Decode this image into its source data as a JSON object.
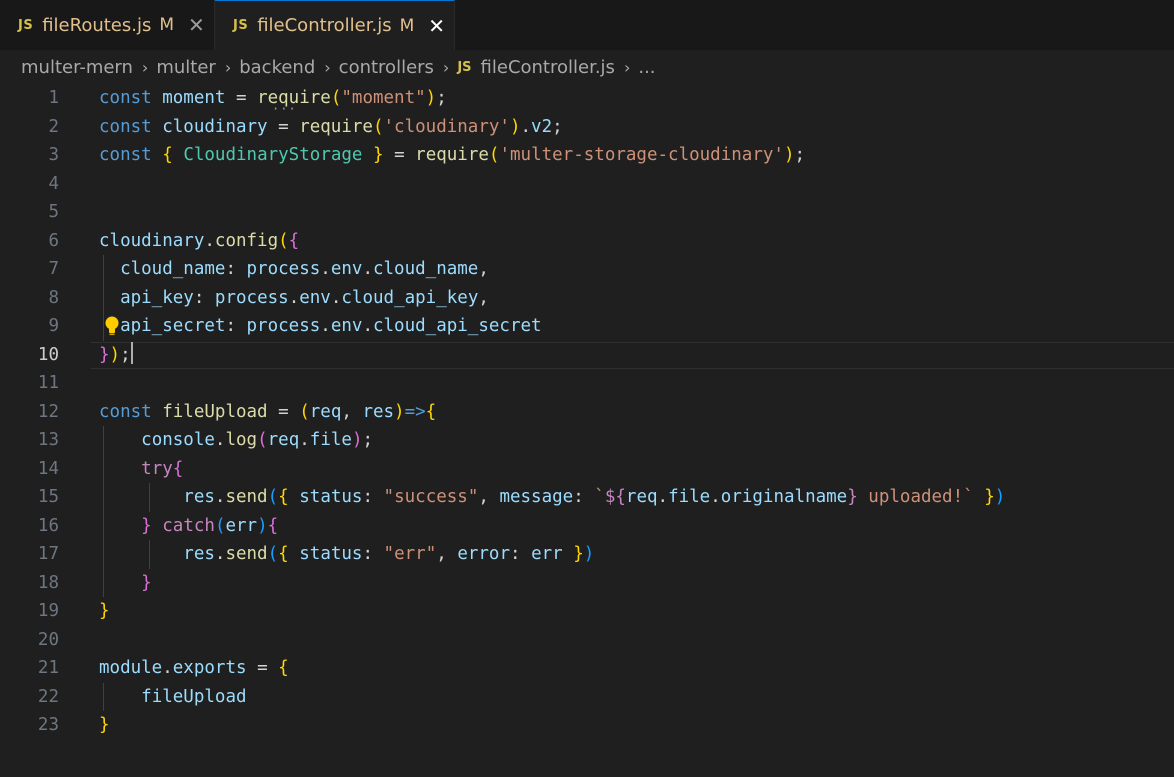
{
  "tabs": [
    {
      "icon": "JS",
      "label": "fileRoutes.js",
      "modified": "M",
      "active": false
    },
    {
      "icon": "JS",
      "label": "fileController.js",
      "modified": "M",
      "active": true
    }
  ],
  "breadcrumb": {
    "items": [
      "multer-mern",
      "multer",
      "backend",
      "controllers"
    ],
    "file_icon": "JS",
    "file": "fileController.js",
    "more": "..."
  },
  "editor": {
    "current_line": 10,
    "line_numbers": [
      "1",
      "2",
      "3",
      "4",
      "5",
      "6",
      "7",
      "8",
      "9",
      "10",
      "11",
      "12",
      "13",
      "14",
      "15",
      "16",
      "17",
      "18",
      "19",
      "20",
      "21",
      "22",
      "23"
    ],
    "lines": [
      [
        [
          "kw",
          "const"
        ],
        [
          "op",
          " "
        ],
        [
          "var",
          "moment"
        ],
        [
          "op",
          " = "
        ],
        [
          "fn",
          "require"
        ],
        [
          "b1",
          "("
        ],
        [
          "str",
          "\"moment\""
        ],
        [
          "b1",
          ")"
        ],
        [
          "op",
          ";"
        ]
      ],
      [
        [
          "kw",
          "const"
        ],
        [
          "op",
          " "
        ],
        [
          "var",
          "cloudinary"
        ],
        [
          "op",
          " = "
        ],
        [
          "fn",
          "require"
        ],
        [
          "b1",
          "("
        ],
        [
          "str",
          "'cloudinary'"
        ],
        [
          "b1",
          ")"
        ],
        [
          "op",
          "."
        ],
        [
          "var",
          "v2"
        ],
        [
          "op",
          ";"
        ]
      ],
      [
        [
          "kw",
          "const"
        ],
        [
          "op",
          " "
        ],
        [
          "b1",
          "{"
        ],
        [
          "op",
          " "
        ],
        [
          "cls",
          "CloudinaryStorage"
        ],
        [
          "op",
          " "
        ],
        [
          "b1",
          "}"
        ],
        [
          "op",
          " = "
        ],
        [
          "fn",
          "require"
        ],
        [
          "b1",
          "("
        ],
        [
          "str",
          "'multer-storage-cloudinary'"
        ],
        [
          "b1",
          ")"
        ],
        [
          "op",
          ";"
        ]
      ],
      [],
      [],
      [
        [
          "var",
          "cloudinary"
        ],
        [
          "op",
          "."
        ],
        [
          "fn",
          "config"
        ],
        [
          "b1",
          "("
        ],
        [
          "b2",
          "{"
        ]
      ],
      [
        [
          "op",
          "  "
        ],
        [
          "var",
          "cloud_name"
        ],
        [
          "op",
          ": "
        ],
        [
          "var",
          "process"
        ],
        [
          "op",
          "."
        ],
        [
          "var",
          "env"
        ],
        [
          "op",
          "."
        ],
        [
          "var",
          "cloud_name"
        ],
        [
          "op",
          ","
        ]
      ],
      [
        [
          "op",
          "  "
        ],
        [
          "var",
          "api_key"
        ],
        [
          "op",
          ": "
        ],
        [
          "var",
          "process"
        ],
        [
          "op",
          "."
        ],
        [
          "var",
          "env"
        ],
        [
          "op",
          "."
        ],
        [
          "var",
          "cloud_api_key"
        ],
        [
          "op",
          ","
        ]
      ],
      [
        [
          "op",
          "  "
        ],
        [
          "var",
          "api_secret"
        ],
        [
          "op",
          ": "
        ],
        [
          "var",
          "process"
        ],
        [
          "op",
          "."
        ],
        [
          "var",
          "env"
        ],
        [
          "op",
          "."
        ],
        [
          "var",
          "cloud_api_secret"
        ]
      ],
      [
        [
          "b2",
          "}"
        ],
        [
          "b1",
          ")"
        ],
        [
          "op",
          ";"
        ]
      ],
      [],
      [
        [
          "kw",
          "const"
        ],
        [
          "op",
          " "
        ],
        [
          "fn",
          "fileUpload"
        ],
        [
          "op",
          " = "
        ],
        [
          "b1",
          "("
        ],
        [
          "var",
          "req"
        ],
        [
          "op",
          ", "
        ],
        [
          "var",
          "res"
        ],
        [
          "b1",
          ")"
        ],
        [
          "kw",
          "=>"
        ],
        [
          "b1",
          "{"
        ]
      ],
      [
        [
          "op",
          "    "
        ],
        [
          "var",
          "console"
        ],
        [
          "op",
          "."
        ],
        [
          "fn",
          "log"
        ],
        [
          "b2",
          "("
        ],
        [
          "var",
          "req"
        ],
        [
          "op",
          "."
        ],
        [
          "var",
          "file"
        ],
        [
          "b2",
          ")"
        ],
        [
          "op",
          ";"
        ]
      ],
      [
        [
          "op",
          "    "
        ],
        [
          "ctrl",
          "try"
        ],
        [
          "b2",
          "{"
        ]
      ],
      [
        [
          "op",
          "        "
        ],
        [
          "var",
          "res"
        ],
        [
          "op",
          "."
        ],
        [
          "fn",
          "send"
        ],
        [
          "b3",
          "("
        ],
        [
          "b1",
          "{"
        ],
        [
          "op",
          " "
        ],
        [
          "var",
          "status"
        ],
        [
          "op",
          ": "
        ],
        [
          "str",
          "\"success\""
        ],
        [
          "op",
          ", "
        ],
        [
          "var",
          "message"
        ],
        [
          "op",
          ": "
        ],
        [
          "str",
          "`"
        ],
        [
          "ctrl",
          "${"
        ],
        [
          "var",
          "req"
        ],
        [
          "op",
          "."
        ],
        [
          "var",
          "file"
        ],
        [
          "op",
          "."
        ],
        [
          "var",
          "originalname"
        ],
        [
          "ctrl",
          "}"
        ],
        [
          "str",
          " uploaded!`"
        ],
        [
          "op",
          " "
        ],
        [
          "b1",
          "}"
        ],
        [
          "b3",
          ")"
        ]
      ],
      [
        [
          "op",
          "    "
        ],
        [
          "b2",
          "}"
        ],
        [
          "op",
          " "
        ],
        [
          "ctrl",
          "catch"
        ],
        [
          "b3",
          "("
        ],
        [
          "var",
          "err"
        ],
        [
          "b3",
          ")"
        ],
        [
          "b2",
          "{"
        ]
      ],
      [
        [
          "op",
          "        "
        ],
        [
          "var",
          "res"
        ],
        [
          "op",
          "."
        ],
        [
          "fn",
          "send"
        ],
        [
          "b3",
          "("
        ],
        [
          "b1",
          "{"
        ],
        [
          "op",
          " "
        ],
        [
          "var",
          "status"
        ],
        [
          "op",
          ": "
        ],
        [
          "str",
          "\"err\""
        ],
        [
          "op",
          ", "
        ],
        [
          "var",
          "error"
        ],
        [
          "op",
          ": "
        ],
        [
          "var",
          "err"
        ],
        [
          "op",
          " "
        ],
        [
          "b1",
          "}"
        ],
        [
          "b3",
          ")"
        ]
      ],
      [
        [
          "op",
          "    "
        ],
        [
          "b2",
          "}"
        ]
      ],
      [
        [
          "b1",
          "}"
        ]
      ],
      [],
      [
        [
          "var",
          "module"
        ],
        [
          "op",
          "."
        ],
        [
          "var",
          "exports"
        ],
        [
          "op",
          " = "
        ],
        [
          "b1",
          "{"
        ]
      ],
      [
        [
          "op",
          "    "
        ],
        [
          "var",
          "fileUpload"
        ]
      ],
      [
        [
          "b1",
          "}"
        ]
      ]
    ]
  },
  "icons": {
    "tab_close": "close-icon",
    "breadcrumb_separator": "chevron-right-icon",
    "lightbulb": "lightbulb-icon"
  }
}
